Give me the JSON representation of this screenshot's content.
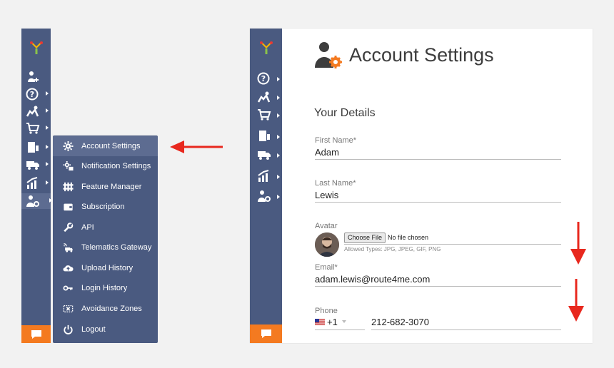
{
  "flyout": {
    "items": [
      {
        "label": "Account Settings",
        "icon": "gear-icon"
      },
      {
        "label": "Notification Settings",
        "icon": "notification-gear-icon"
      },
      {
        "label": "Feature Manager",
        "icon": "puzzle-icon"
      },
      {
        "label": "Subscription",
        "icon": "wallet-icon"
      },
      {
        "label": "API",
        "icon": "wrench-icon"
      },
      {
        "label": "Telematics Gateway",
        "icon": "truck-signal-icon"
      },
      {
        "label": "Upload History",
        "icon": "cloud-upload-icon"
      },
      {
        "label": "Login History",
        "icon": "key-icon"
      },
      {
        "label": "Avoidance Zones",
        "icon": "zone-x-icon"
      },
      {
        "label": "Logout",
        "icon": "power-icon"
      }
    ]
  },
  "main": {
    "title": "Account Settings",
    "section": "Your Details",
    "first_name": {
      "label": "First Name*",
      "value": "Adam"
    },
    "last_name": {
      "label": "Last Name*",
      "value": "Lewis"
    },
    "avatar": {
      "label": "Avatar",
      "button": "Choose File",
      "status": "No file chosen",
      "allowed": "Allowed Types: JPG, JPEG, GIF, PNG"
    },
    "email": {
      "label": "Email*",
      "value": "adam.lewis@route4me.com"
    },
    "phone": {
      "label": "Phone",
      "code": "+1",
      "value": "212-682-3070"
    }
  },
  "colors": {
    "sidebar": "#4a5a80",
    "sidebar_active": "#5d6c91",
    "chat": "#f47a20",
    "arrow": "#e8281e",
    "accent": "#f47a20"
  }
}
